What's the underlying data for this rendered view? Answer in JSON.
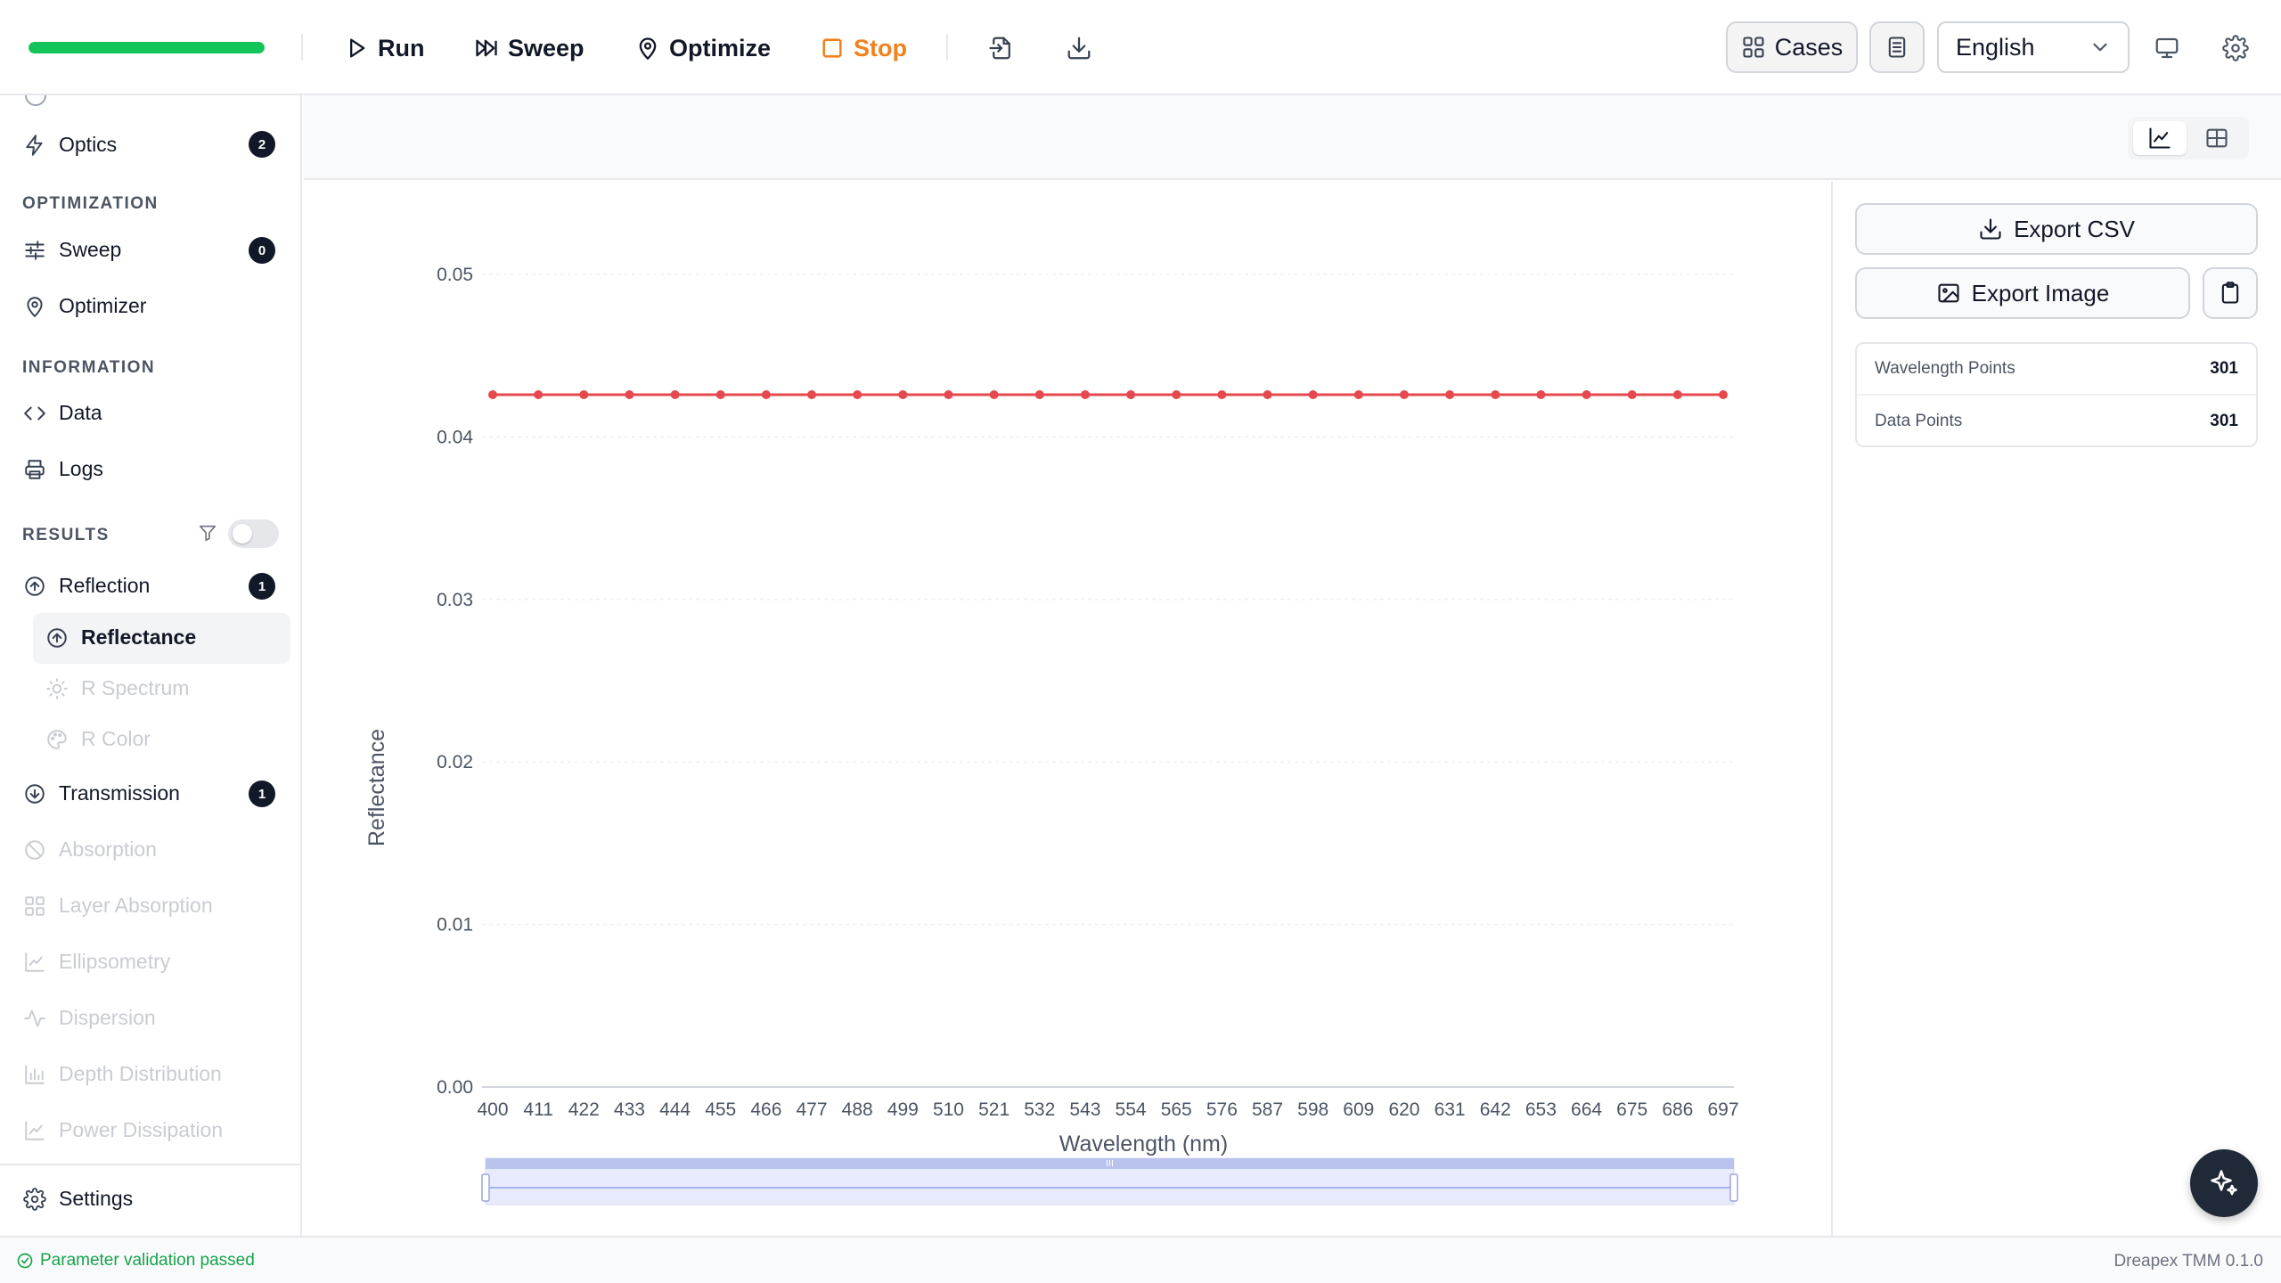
{
  "toolbar": {
    "progress": 1.0,
    "progress_color": "#12c45a",
    "run_label": "Run",
    "sweep_label": "Sweep",
    "optimize_label": "Optimize",
    "stop_label": "Stop",
    "stop_color": "#f0821e",
    "import_icon": "import-icon",
    "download_icon": "download-icon",
    "cases_label": "Cases",
    "language_value": "English",
    "monitor_icon": "monitor-icon",
    "settings_icon": "gear-icon"
  },
  "sidebar": {
    "items": [
      {
        "key": "optics",
        "label": "Optics",
        "icon": "lightning-icon",
        "badge": "2"
      },
      {
        "key": "section-optimization",
        "label": "OPTIMIZATION"
      },
      {
        "key": "sweep",
        "label": "Sweep",
        "icon": "sliders-icon",
        "badge": "0"
      },
      {
        "key": "optimizer",
        "label": "Optimizer",
        "icon": "map-pin-icon"
      },
      {
        "key": "section-information",
        "label": "INFORMATION"
      },
      {
        "key": "data",
        "label": "Data",
        "icon": "code-icon"
      },
      {
        "key": "logs",
        "label": "Logs",
        "icon": "printer-icon"
      },
      {
        "key": "section-results",
        "label": "RESULTS"
      },
      {
        "key": "reflection",
        "label": "Reflection",
        "icon": "arrow-up-circle-icon",
        "badge": "1"
      },
      {
        "key": "reflectance",
        "label": "Reflectance",
        "icon": "arrow-up-circle-icon",
        "active": true
      },
      {
        "key": "r-spectrum",
        "label": "R Spectrum",
        "icon": "sun-icon",
        "disabled": true
      },
      {
        "key": "r-color",
        "label": "R Color",
        "icon": "palette-icon",
        "disabled": true
      },
      {
        "key": "transmission",
        "label": "Transmission",
        "icon": "arrow-down-circle-icon",
        "badge": "1"
      },
      {
        "key": "absorption",
        "label": "Absorption",
        "icon": "ban-icon",
        "disabled": true
      },
      {
        "key": "layer-absorption",
        "label": "Layer Absorption",
        "icon": "grid-icon",
        "disabled": true
      },
      {
        "key": "ellipsometry",
        "label": "Ellipsometry",
        "icon": "chart-line-icon",
        "disabled": true
      },
      {
        "key": "dispersion",
        "label": "Dispersion",
        "icon": "activity-icon",
        "disabled": true
      },
      {
        "key": "depth-distribution",
        "label": "Depth Distribution",
        "icon": "bar-chart-icon",
        "disabled": true
      },
      {
        "key": "power-dissipation",
        "label": "Power Dissipation",
        "icon": "chart-line-icon",
        "disabled": true
      }
    ],
    "results_filter_icon": "filter-icon",
    "results_filter_enabled": false,
    "settings_label": "Settings"
  },
  "view": {
    "chart_icon": "line-chart-icon",
    "table_icon": "table-icon",
    "active": "chart"
  },
  "panel": {
    "export_csv_label": "Export CSV",
    "export_image_label": "Export Image",
    "clipboard_icon": "clipboard-icon",
    "stats": [
      {
        "label": "Wavelength Points",
        "value": "301"
      },
      {
        "label": "Data Points",
        "value": "301"
      }
    ]
  },
  "chart_data": {
    "type": "line",
    "title": "",
    "xlabel": "Wavelength (nm)",
    "ylabel": "Reflectance",
    "x": [
      400,
      411,
      422,
      433,
      444,
      455,
      466,
      477,
      488,
      499,
      510,
      521,
      532,
      543,
      554,
      565,
      576,
      587,
      598,
      609,
      620,
      631,
      642,
      653,
      664,
      675,
      686,
      697
    ],
    "x_tick_labels": [
      "400",
      "411",
      "422",
      "433",
      "444",
      "455",
      "466",
      "477",
      "488",
      "499",
      "510",
      "521",
      "532",
      "543",
      "554",
      "565",
      "576",
      "587",
      "598",
      "609",
      "620",
      "631",
      "642",
      "653",
      "664",
      "675",
      "686",
      "697"
    ],
    "y_ticks": [
      0.0,
      0.01,
      0.02,
      0.03,
      0.04,
      0.05
    ],
    "y_tick_labels": [
      "0.00",
      "0.01",
      "0.02",
      "0.03",
      "0.04",
      "0.05"
    ],
    "xlim": [
      400,
      700
    ],
    "ylim": [
      0,
      0.05
    ],
    "grid": true,
    "data_zoom": [
      0,
      1
    ],
    "series": [
      {
        "color": "#e5484d",
        "values": [
          0.0426,
          0.0426,
          0.0426,
          0.0426,
          0.0426,
          0.0426,
          0.0426,
          0.0426,
          0.0426,
          0.0426,
          0.0426,
          0.0426,
          0.0426,
          0.0426,
          0.0426,
          0.0426,
          0.0426,
          0.0426,
          0.0426,
          0.0426,
          0.0426,
          0.0426,
          0.0426,
          0.0426,
          0.0426,
          0.0426,
          0.0426,
          0.0426
        ]
      }
    ]
  },
  "status": {
    "message": "Parameter validation passed",
    "version": "Dreapex TMM 0.1.0"
  }
}
